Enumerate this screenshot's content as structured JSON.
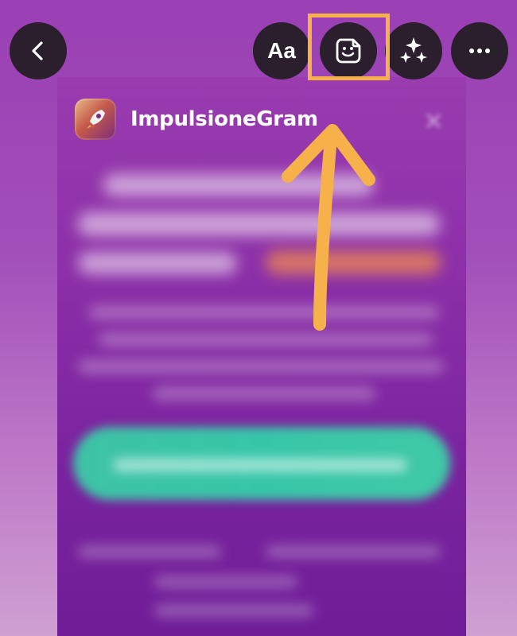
{
  "toolbar": {
    "back_icon": "chevron-left-icon",
    "text_label": "Aa",
    "sticker_icon": "sticker-icon",
    "effects_icon": "sparkles-icon",
    "more_icon": "more-horizontal-icon"
  },
  "story": {
    "app_name": "ImpulsioneGram",
    "app_logo_icon": "rocket-icon",
    "close_icon": "close-icon"
  },
  "annotation": {
    "highlight_color": "#f7b14a",
    "arrow_icon": "arrow-up-icon"
  },
  "colors": {
    "toolbar_button_bg": "#2b1f2e",
    "cta_green": "#3fc3a6",
    "card_purple": "#8c2fa8"
  }
}
